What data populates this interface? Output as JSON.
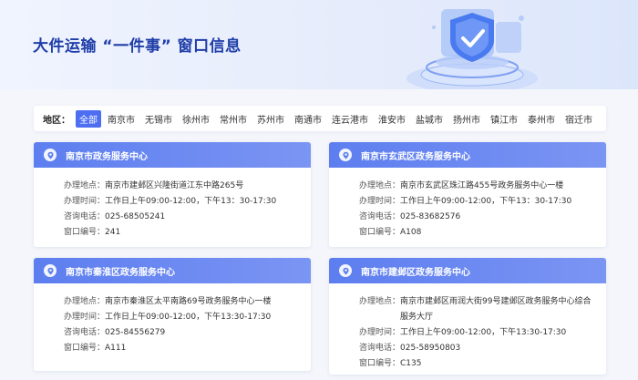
{
  "page": {
    "title": "大件运输 “一件事” 窗口信息"
  },
  "filter": {
    "label": "地区：",
    "regions": [
      "全部",
      "南京市",
      "无锡市",
      "徐州市",
      "常州市",
      "苏州市",
      "南通市",
      "连云港市",
      "淮安市",
      "盐城市",
      "扬州市",
      "镇江市",
      "泰州市",
      "宿迁市"
    ],
    "selected": "全部"
  },
  "field_labels": {
    "address": "办理地点：",
    "hours": "办理时间：",
    "phone": "咨询电话：",
    "window": "窗口编号："
  },
  "cards": [
    {
      "name": "南京市政务服务中心",
      "address": "南京市建邺区兴隆街道江东中路265号",
      "hours": "工作日上午09:00-12:00，下午13：30-17:30",
      "phone": "025-68505241",
      "window": "241"
    },
    {
      "name": "南京市玄武区政务服务中心",
      "address": "南京市玄武区珠江路455号政务服务中心一楼",
      "hours": "工作日上午09:00-12:00，下午13：30-17:30",
      "phone": "025-83682576",
      "window": "A108"
    },
    {
      "name": "南京市秦淮区政务服务中心",
      "address": "南京市秦淮区太平南路69号政务服务中心一楼",
      "hours": "工作日上午09:00-12:00，下午13:30-17:30",
      "phone": "025-84556279",
      "window": "A111"
    },
    {
      "name": "南京市建邺区政务服务中心",
      "address": "南京市建邺区雨润大街99号建邺区政务服务中心综合服务大厅",
      "hours": "工作日上午09:00-12:00，下午13:30-17:30",
      "phone": "025-58950803",
      "window": "C135"
    }
  ],
  "colors": {
    "accent": "#4d6ef0",
    "title": "#1f3ea8",
    "card_header": "#5d7ef0",
    "background": "#f4f6fb"
  },
  "icons": {
    "card": "location-pin-icon"
  }
}
